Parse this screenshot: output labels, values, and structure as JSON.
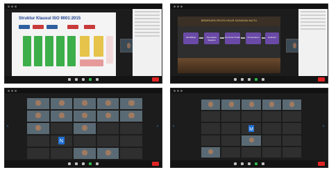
{
  "panels": {
    "p1": {
      "slide_title": "Struktur Klausul ISO 9001:2015",
      "boxes_top": [
        "",
        "",
        "",
        "",
        ""
      ],
      "side_label": ""
    },
    "p2": {
      "slide_title": "BEBERAPA REVISI HKUR SASARAN MUTU",
      "steps": [
        "Identifikasi",
        "Penetapan Sasaran",
        "Rencana Tindak",
        "Pemantauan",
        "Evaluasi"
      ]
    },
    "p3": {
      "tiles": [
        {
          "type": "video",
          "name": ""
        },
        {
          "type": "video",
          "name": ""
        },
        {
          "type": "video",
          "name": ""
        },
        {
          "type": "video",
          "name": ""
        },
        {
          "type": "video",
          "name": ""
        },
        {
          "type": "video",
          "name": ""
        },
        {
          "type": "video",
          "name": ""
        },
        {
          "type": "video",
          "name": ""
        },
        {
          "type": "video",
          "name": ""
        },
        {
          "type": "video",
          "name": ""
        },
        {
          "type": "video",
          "name": ""
        },
        {
          "type": "dark",
          "name": ""
        },
        {
          "type": "video",
          "name": ""
        },
        {
          "type": "dark",
          "name": ""
        },
        {
          "type": "dark",
          "name": ""
        },
        {
          "type": "dark",
          "name": ""
        },
        {
          "type": "avatar",
          "name": "",
          "letter": "N"
        },
        {
          "type": "dark",
          "name": ""
        },
        {
          "type": "dark",
          "name": ""
        },
        {
          "type": "dark",
          "name": ""
        },
        {
          "type": "dark",
          "name": ""
        },
        {
          "type": "dark",
          "name": ""
        },
        {
          "type": "video",
          "name": ""
        },
        {
          "type": "video",
          "name": ""
        },
        {
          "type": "dark",
          "name": ""
        }
      ]
    },
    "p4": {
      "tiles": [
        {
          "type": "video",
          "name": ""
        },
        {
          "type": "video",
          "name": ""
        },
        {
          "type": "video",
          "name": ""
        },
        {
          "type": "video",
          "name": ""
        },
        {
          "type": "video",
          "name": ""
        },
        {
          "type": "dark",
          "name": ""
        },
        {
          "type": "dark",
          "name": ""
        },
        {
          "type": "dark",
          "name": ""
        },
        {
          "type": "dark",
          "name": ""
        },
        {
          "type": "dark",
          "name": ""
        },
        {
          "type": "dark",
          "name": ""
        },
        {
          "type": "dark",
          "name": ""
        },
        {
          "type": "avatar",
          "name": "",
          "letter": "M"
        },
        {
          "type": "dark",
          "name": ""
        },
        {
          "type": "dark",
          "name": ""
        },
        {
          "type": "dark",
          "name": ""
        },
        {
          "type": "dark",
          "name": ""
        },
        {
          "type": "video",
          "name": ""
        },
        {
          "type": "dark",
          "name": ""
        },
        {
          "type": "dark",
          "name": ""
        },
        {
          "type": "video",
          "name": ""
        },
        {
          "type": "dark",
          "name": ""
        },
        {
          "type": "dark",
          "name": ""
        },
        {
          "type": "dark",
          "name": ""
        },
        {
          "type": "dark",
          "name": ""
        }
      ]
    }
  },
  "colors": {
    "accent": "#2db84a",
    "end": "#e02424",
    "avatar": "#1f6fd1",
    "slide_title": "#1a3f8f"
  }
}
